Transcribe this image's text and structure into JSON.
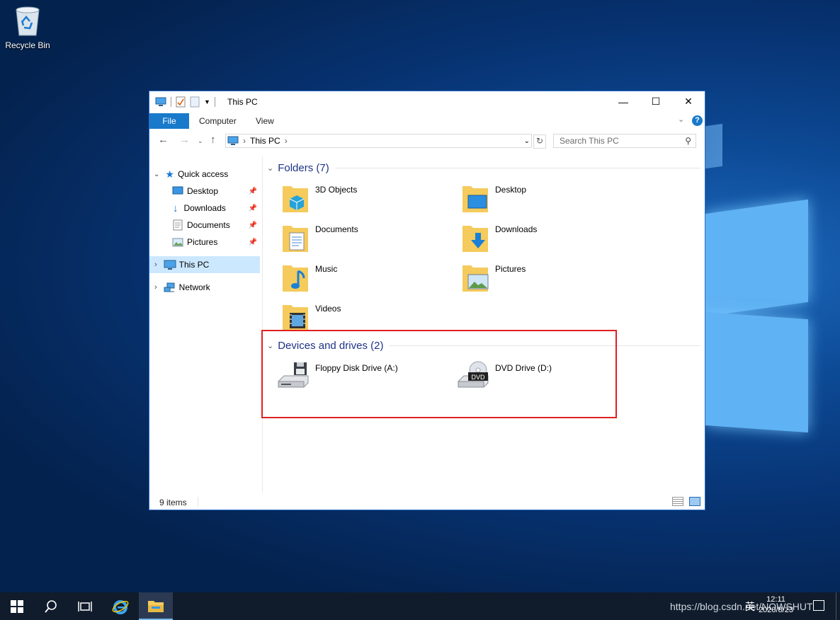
{
  "desktop": {
    "recycle_bin_label": "Recycle Bin"
  },
  "window": {
    "title": "This PC",
    "ribbon_tabs": [
      "File",
      "Computer",
      "View"
    ],
    "address": {
      "crumb_root": "This PC",
      "search_placeholder": "Search This PC"
    },
    "nav": {
      "quick_access": "Quick access",
      "pinned": [
        "Desktop",
        "Downloads",
        "Documents",
        "Pictures"
      ],
      "this_pc": "This PC",
      "network": "Network"
    },
    "folders_header": "Folders (7)",
    "folders": [
      "3D Objects",
      "Desktop",
      "Documents",
      "Downloads",
      "Music",
      "Pictures",
      "Videos"
    ],
    "devices_header": "Devices and drives (2)",
    "devices": [
      "Floppy Disk Drive (A:)",
      "DVD Drive (D:)"
    ],
    "dvd_badge": "DVD",
    "status_items": "9 items"
  },
  "taskbar": {
    "time": "12:11",
    "date": "2020/8/23",
    "watermark": "https://blog.csdn.net/NOWSHUT",
    "ime": "英"
  },
  "colors": {
    "accent": "#1979ca",
    "selection": "#cce8ff",
    "group_header": "#1e3287",
    "highlight_box": "#e02020"
  }
}
